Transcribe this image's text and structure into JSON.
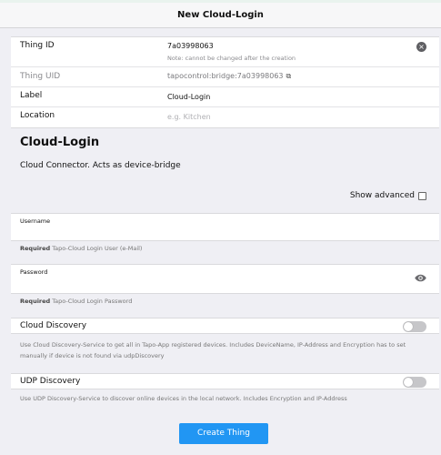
{
  "header": {
    "title": "New Cloud-Login"
  },
  "fields": {
    "thing_id": {
      "label": "Thing ID",
      "value": "7a03998063",
      "note": "Note: cannot be changed after the creation"
    },
    "thing_uid": {
      "label": "Thing UID",
      "value": "tapocontrol:bridge:7a03998063"
    },
    "label": {
      "label": "Label",
      "value": "Cloud-Login"
    },
    "location": {
      "label": "Location",
      "placeholder": "e.g. Kitchen"
    }
  },
  "section": {
    "title": "Cloud-Login",
    "description": "Cloud Connector. Acts as device-bridge"
  },
  "show_advanced": {
    "label": "Show advanced",
    "checked": false
  },
  "username": {
    "label": "Username",
    "value": "",
    "required": "Required",
    "hint": "Tapo-Cloud Login User (e-Mail)"
  },
  "password": {
    "label": "Password",
    "value": "",
    "required": "Required",
    "hint": "Tapo-Cloud Login Password"
  },
  "cloud_discovery": {
    "label": "Cloud Discovery",
    "enabled": false,
    "description": "Use Cloud Discovery-Service to get all in Tapo-App registered devices. Includes DeviceName, IP-Address and Encryption has to set manually if device is not found via udpDiscovery"
  },
  "udp_discovery": {
    "label": "UDP Discovery",
    "enabled": false,
    "description": "Use UDP Discovery-Service to discover online devices in the local network. Includes Encryption and IP-Address"
  },
  "actions": {
    "create_label": "Create Thing"
  },
  "icons": {
    "clear": "clear-icon",
    "copy": "copy-icon",
    "eye": "eye-icon"
  },
  "colors": {
    "primary": "#2196f3",
    "background": "#efeff4"
  }
}
